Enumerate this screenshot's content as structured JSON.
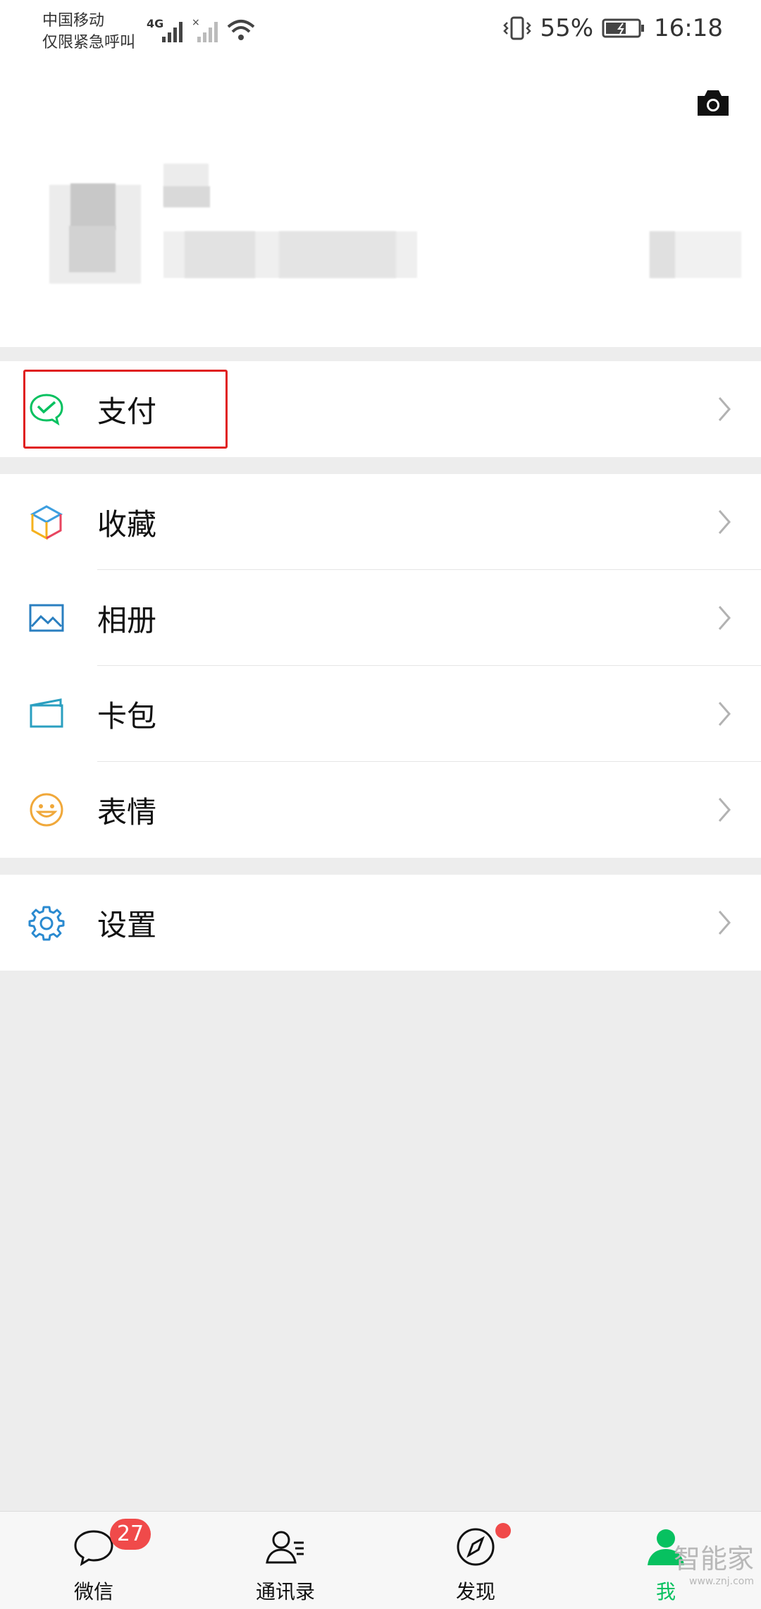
{
  "status_bar": {
    "carrier_line1": "中国移动",
    "carrier_line2": "仅限紧急呼叫",
    "network": "4G",
    "battery": "55%",
    "time": "16:18"
  },
  "menu": {
    "pay": "支付",
    "favorites": "收藏",
    "album": "相册",
    "wallet": "卡包",
    "stickers": "表情",
    "settings": "设置"
  },
  "tabs": {
    "chats": "微信",
    "chats_badge": "27",
    "contacts": "通讯录",
    "discover": "发现",
    "me": "我"
  },
  "watermark": {
    "text": "智能家",
    "url": "www.znj.com"
  },
  "colors": {
    "accent_green": "#07c160",
    "badge_red": "#f04a4a",
    "highlight_red": "#e02020"
  }
}
